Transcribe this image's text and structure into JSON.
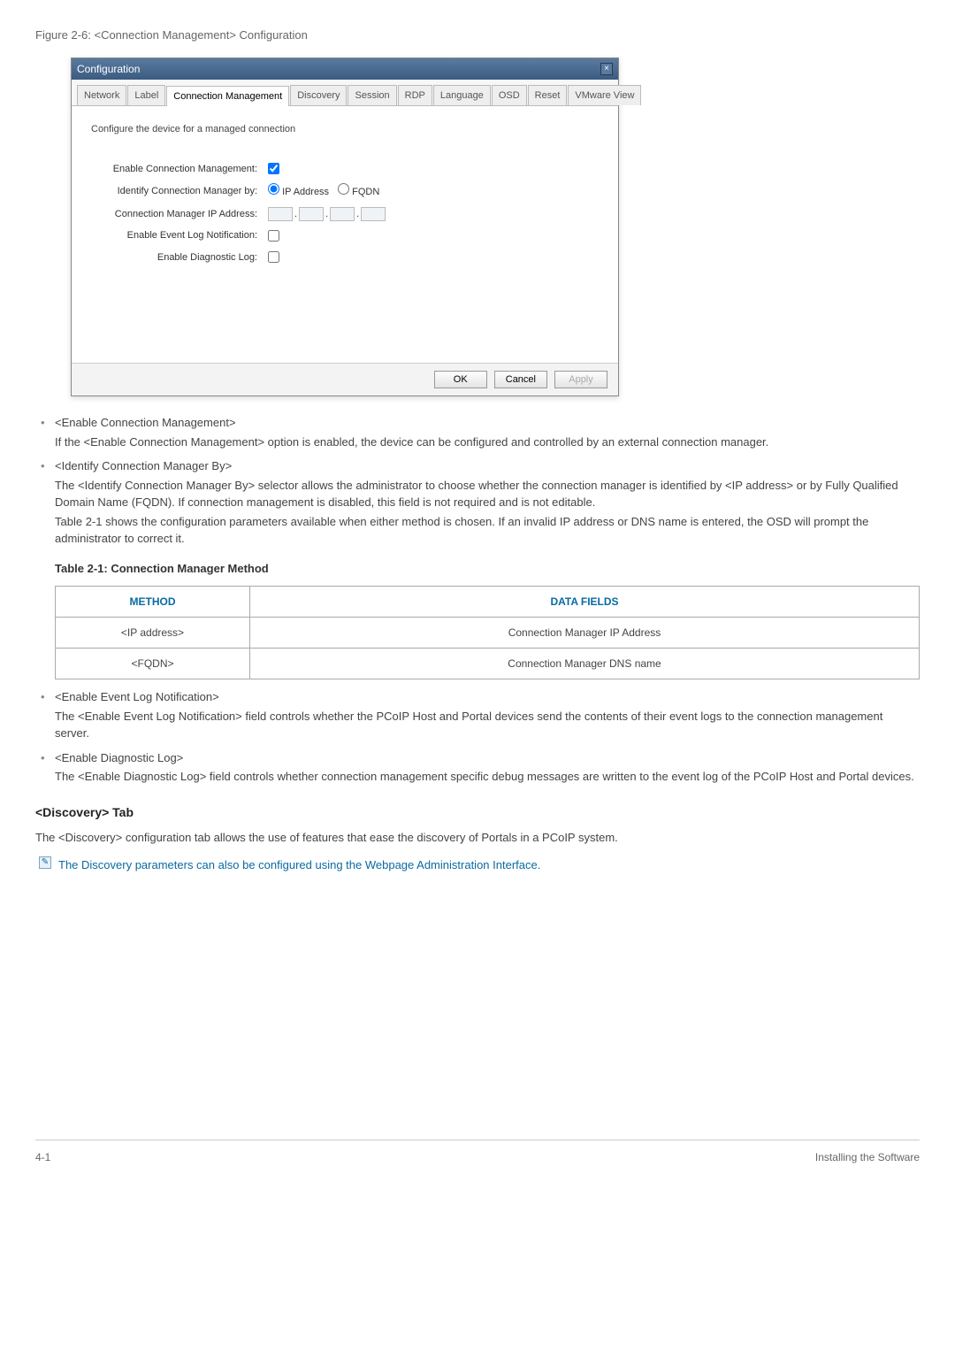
{
  "figure_caption": "Figure 2-6: <Connection Management> Configuration",
  "dialog": {
    "title": "Configuration",
    "close_glyph": "×",
    "tabs": [
      "Network",
      "Label",
      "Connection Management",
      "Discovery",
      "Session",
      "RDP",
      "Language",
      "OSD",
      "Reset",
      "VMware View"
    ],
    "active_tab_index": 2,
    "instruction": "Configure the device for a managed connection",
    "labels": {
      "enable_cm": "Enable Connection Management:",
      "identify_by": "Identify Connection Manager by:",
      "cm_ip": "Connection Manager IP Address:",
      "enable_evt": "Enable Event Log Notification:",
      "enable_diag": "Enable Diagnostic Log:"
    },
    "radio": {
      "ip": "IP Address",
      "fqdn": "FQDN"
    },
    "buttons": {
      "ok": "OK",
      "cancel": "Cancel",
      "apply": "Apply"
    }
  },
  "bullets1": [
    {
      "title": "<Enable Connection Management>",
      "body": "If the <Enable Connection Management> option is enabled, the device can be configured and controlled by an external connection manager."
    },
    {
      "title": "<Identify Connection Manager By>",
      "body": "The <Identify Connection Manager By> selector allows the administrator to choose whether the connection manager is identified by <IP address> or by Fully Qualified Domain Name (FQDN).  If connection management is disabled, this field is not required and is not editable.",
      "body2": "Table 2-1 shows the configuration parameters available when either method is chosen. If an invalid IP address or DNS name is entered, the OSD will prompt the administrator to correct it."
    }
  ],
  "table": {
    "caption": "Table 2-1: Connection Manager Method",
    "headers": [
      "METHOD",
      "DATA FIELDS"
    ],
    "rows": [
      [
        "<IP address>",
        "Connection Manager IP Address"
      ],
      [
        "<FQDN>",
        "Connection Manager DNS name"
      ]
    ]
  },
  "bullets2": [
    {
      "title": "<Enable Event Log Notification>",
      "body": "The <Enable Event Log Notification> field controls whether the PCoIP Host and Portal devices send the contents of their event logs to the connection management server."
    },
    {
      "title": "<Enable Diagnostic Log>",
      "body": "The <Enable Diagnostic Log> field controls whether connection management specific debug messages are written to the event log of the PCoIP Host and Portal devices."
    }
  ],
  "section": {
    "heading": "<Discovery> Tab",
    "para": "The <Discovery> configuration tab allows the use of features that ease the discovery of Portals in a PCoIP system.",
    "note": "The Discovery parameters can also be configured using the Webpage Administration Interface."
  },
  "footer": {
    "left": "4-1",
    "right": "Installing the Software"
  }
}
